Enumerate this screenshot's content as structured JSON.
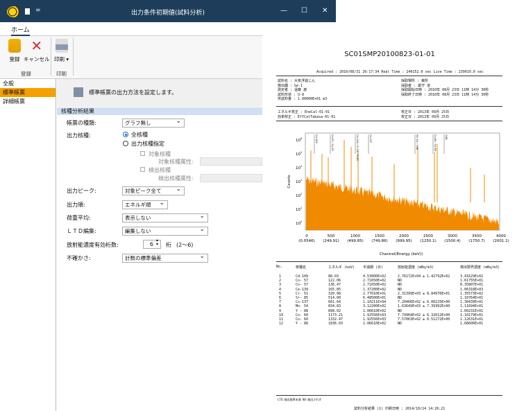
{
  "window": {
    "title": "出力条件初期値(試料分析)",
    "pin": "=",
    "minimize": "—",
    "maximize": "☐",
    "close": "✕"
  },
  "ribbon": {
    "tab": "ホーム",
    "register": "登録",
    "cancel": "キャンセル",
    "print": "印刷 ▾",
    "group_register": "登録",
    "group_print": "印刷"
  },
  "sidebar": {
    "items": [
      {
        "label": "全般"
      },
      {
        "label": "標準帳票"
      },
      {
        "label": "詳細帳票"
      }
    ]
  },
  "banner": {
    "text": "標準帳票の出力方法を設定します。"
  },
  "section": {
    "title": "核種分析結果"
  },
  "form": {
    "chart_type": {
      "label": "帳票の種類:",
      "value": "グラフ無し"
    },
    "output_nuclide": {
      "label": "出力核種:",
      "opt_all": "全核種",
      "opt_specify": "出力核種指定",
      "target_nuclide": "対象核種",
      "target_attr": "対象核種属性:",
      "detected_nuclide": "検出核種",
      "detected_attr": "検出核種属性:"
    },
    "output_peak": {
      "label": "出力ピーク:",
      "value": "対象ピーク全て"
    },
    "output_order": {
      "label": "出力順:",
      "value": "エネルギ順"
    },
    "load_avg": {
      "label": "荷重平均:",
      "value": "表示しない"
    },
    "ltd": {
      "label": "ＬＴＤ編集:",
      "value": "編集しない"
    },
    "digits": {
      "label": "放射能濃度有効桁数:",
      "value": "6",
      "unit": "桁",
      "range": "(2〜6)"
    },
    "uncertainty": {
      "label": "不確かさ:",
      "value": "計数の標準偏差"
    }
  },
  "report": {
    "title": "SC01SMP20100823-01-01",
    "acq": "Acquired : 2010/08/31 20:17:34    Real Time : 240152.0 sec    Live Time : 239019.0 sec",
    "meta_left": [
      "試料名   : 大気浮遊じん",
      "検出器   : Ge-1",
      "測定者   : 遠藤 渡",
      "試料形状 : U-8",
      "供試料量 : 1.00000E+01 m3"
    ],
    "meta_right": [
      "採取場所     : 東所",
      "採取者       : 最守 道",
      "採取開始日時 : 2010年 08月 23日 11時 14分 30秒",
      "採取終了日時 : 2010年 08月 23日 11時 14分 30秒"
    ],
    "cal_left": [
      "エネルギ校正    : EneCal-01-01",
      "効率校正        : EffCalTakasa-01-01"
    ],
    "cal_right": [
      "校正日 : 2013年 09月 25日",
      "校正日 : 2013年 09月 25日"
    ],
    "xlabel": "Channel(Energy (keV))",
    "ylabel": "Counts",
    "xticks": [
      {
        "ch": "0",
        "e": "(0.0546)"
      },
      {
        "ch": "500",
        "e": "(249.91)"
      },
      {
        "ch": "1000",
        "e": "(499.85)"
      },
      {
        "ch": "1500",
        "e": "(749.86)"
      },
      {
        "ch": "2000",
        "e": "(999.95)"
      },
      {
        "ch": "2500",
        "e": "(1250.1)"
      },
      {
        "ch": "3000",
        "e": "(1500.4)"
      },
      {
        "ch": "3500",
        "e": "(1750.7)"
      },
      {
        "ch": "4000",
        "e": "(2001.1)"
      }
    ],
    "yticks": [
      "10",
      "10",
      "10",
      "10",
      "10",
      "10",
      "10"
    ],
    "yexp": [
      "0",
      "1",
      "2",
      "3",
      "4",
      "5",
      "6"
    ],
    "peak_labels": [
      "Cd-109",
      "Co-57 / Co-57",
      "Ce-139 / Cr-51 / Sr-85",
      "Cs-137",
      "Mn-54 / Y-88",
      "Co-60 / Co-60",
      "Y-88"
    ],
    "table_headers": [
      "No.",
      "核種名",
      "エネルギ (keV)",
      "半減期 (日)",
      "放射能濃度 (mBq/m3)",
      "検出限界濃度 (mBq/m3)"
    ],
    "rows": [
      [
        "1",
        "Cd-109",
        "88.03",
        "4.53000E+02",
        "2.76172E+04 ± 1.42792E+02",
        "3.41629E+02"
      ],
      [
        "2",
        "Co- 57",
        "122.06",
        "2.71650E+02",
        "ND",
        "1.61755E+01"
      ],
      [
        "3",
        "Co- 57",
        "136.47",
        "2.71650E+02",
        "ND",
        "8.35807E+01"
      ],
      [
        "4",
        "Ce-139",
        "165.85",
        "1.37200E+02",
        "ND",
        "1.06318E+03"
      ],
      [
        "5",
        "Cr- 51",
        "320.08",
        "2.77010E+01",
        "2.31399E+03 ± 8.84976E+01",
        "1.35573E+02"
      ],
      [
        "6",
        "Sr- 85",
        "514.00",
        "6.48500E+01",
        "ND",
        "1.10764E+01"
      ],
      [
        "7",
        "Cs-137",
        "661.64",
        "1.10211E+04",
        "7.20466E+02 ± 6.00225E+00",
        "1.30439E+01"
      ],
      [
        "8",
        "Mn- 54",
        "834.83",
        "3.12200E+02",
        "1.63649E+03 ± 7.39302E+00",
        "1.11694E+01"
      ],
      [
        "9",
        "Y - 88",
        "898.02",
        "1.06610E+02",
        "ND",
        "1.60231E+01"
      ],
      [
        "10",
        "Co- 60",
        "1173.21",
        "1.92556E+03",
        "7.74964E+02 ± 6.32012E+00",
        "1.10179E+01"
      ],
      [
        "11",
        "Co- 60",
        "1332.47",
        "1.92556E+03",
        "7.57063E+02 ± 6.51272E+00",
        "1.12631E+01"
      ],
      [
        "12",
        "Y - 88",
        "1836.03",
        "1.06610E+02",
        "ND",
        "1.68600E+01"
      ]
    ],
    "footer_note": "LTD:検出限界未満  ND:検出されず",
    "footer": "試料分析結果 (1)  印刷日時 : 2014/10/24 14:26:21"
  }
}
